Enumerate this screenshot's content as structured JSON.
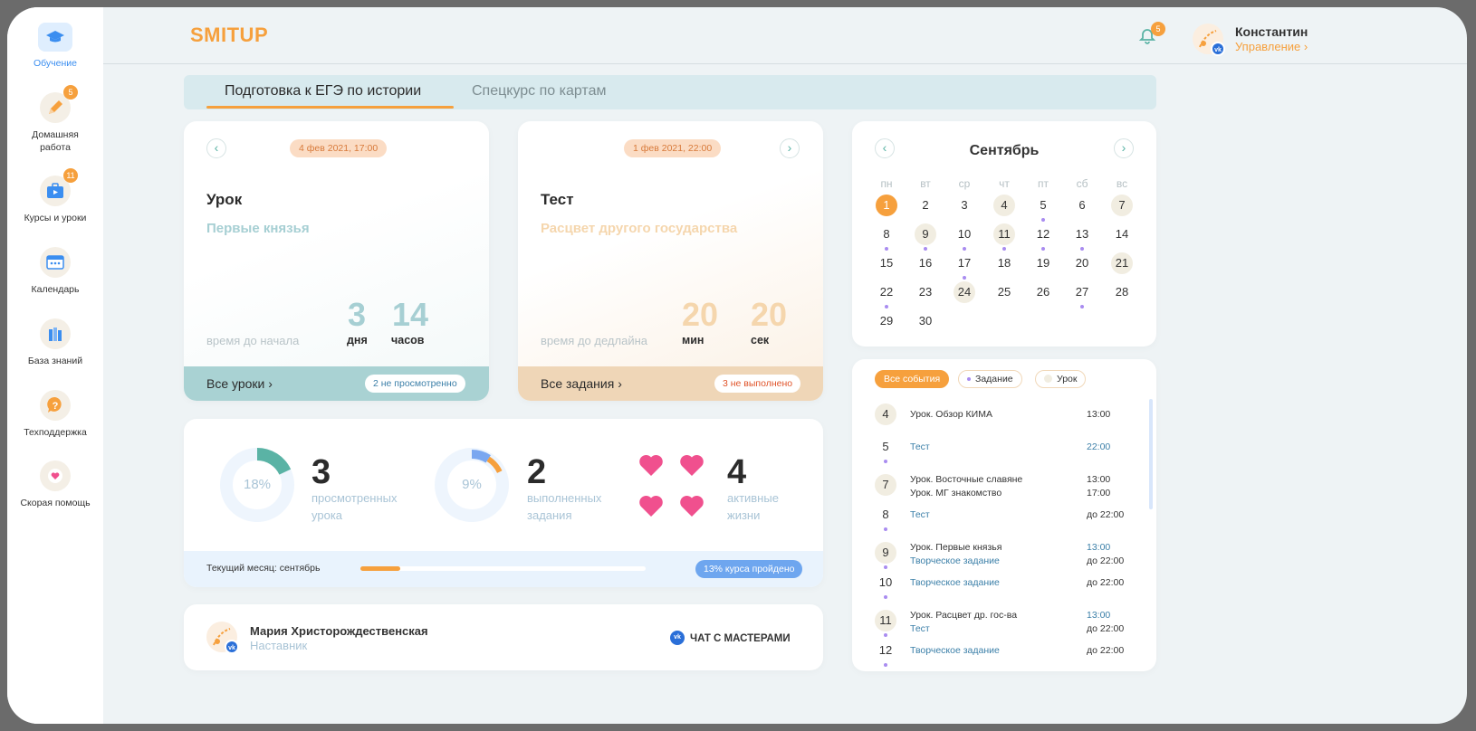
{
  "sidebar": {
    "items": [
      {
        "label": "Обучение",
        "badge": ""
      },
      {
        "label": "Домашняя работа",
        "badge": "5"
      },
      {
        "label": "Курсы и уроки",
        "badge": "11"
      },
      {
        "label": "Календарь",
        "badge": ""
      },
      {
        "label": "База знаний",
        "badge": ""
      },
      {
        "label": "Техподдержка",
        "badge": ""
      },
      {
        "label": "Скорая помощь",
        "badge": ""
      }
    ]
  },
  "header": {
    "logo": "SMITUP",
    "notifications": "5",
    "user_name": "Константин",
    "user_link": "Управление ›"
  },
  "tabs": [
    "Подготовка к ЕГЭ по истории",
    "Спецкурс по картам"
  ],
  "lesson_card": {
    "date": "4 фев 2021, 17:00",
    "title": "Урок",
    "subtitle": "Первые князья",
    "time_label": "время до начала",
    "num1": "3",
    "unit1": "дня",
    "num2": "14",
    "unit2": "часов",
    "footer_link": "Все уроки",
    "footer_pill": "2 не просмотренно"
  },
  "test_card": {
    "date": "1 фев 2021, 22:00",
    "title": "Тест",
    "subtitle": "Расцвет другого государства",
    "time_label": "время до дедлайна",
    "num1": "20",
    "unit1": "мин",
    "num2": "20",
    "unit2": "сек",
    "footer_link": "Все задания",
    "footer_pill": "3 не выполнено"
  },
  "stats": {
    "lessons_percent": "18%",
    "lessons_fraction": 0.18,
    "lessons_count": "3",
    "lessons_label1": "просмотренных",
    "lessons_label2": "урока",
    "tasks_percent": "9%",
    "tasks_fraction": 0.09,
    "tasks_count": "2",
    "tasks_label1": "выполненных",
    "tasks_label2": "задания",
    "lives_count": "4",
    "lives_label1": "активные",
    "lives_label2": "жизни",
    "month_label": "Текущий месяц: сентябрь",
    "month_progress": 0.14,
    "course_pill": "13% курса пройдено"
  },
  "mentor": {
    "name": "Мария Христорождественская",
    "role": "Наставник",
    "chat": "ЧАТ С МАСТЕРАМИ"
  },
  "calendar": {
    "month": "Сентябрь",
    "dow": [
      "пн",
      "вт",
      "ср",
      "чт",
      "пт",
      "сб",
      "вс"
    ],
    "days": [
      "1",
      "2",
      "3",
      "4",
      "5",
      "6",
      "7",
      "8",
      "9",
      "10",
      "11",
      "12",
      "13",
      "14",
      "15",
      "16",
      "17",
      "18",
      "19",
      "20",
      "21",
      "22",
      "23",
      "24",
      "25",
      "26",
      "27",
      "28",
      "29",
      "30"
    ],
    "today": "1",
    "highlighted": [
      "4",
      "7",
      "9",
      "11",
      "21",
      "24"
    ],
    "dotted": [
      "5",
      "8",
      "9",
      "10",
      "11",
      "12",
      "13",
      "17",
      "22",
      "27"
    ]
  },
  "events": {
    "filters": [
      "Все события",
      "Задание",
      "Урок"
    ],
    "items": [
      {
        "day": "4",
        "lines": [
          "Урок. Обзор КИМА"
        ],
        "times": [
          "13:00"
        ],
        "hl": true,
        "dot": false,
        "blue": [
          false
        ],
        "tblue": [
          false
        ]
      },
      {
        "day": "5",
        "lines": [
          "Тест"
        ],
        "times": [
          "22:00"
        ],
        "hl": false,
        "dot": true,
        "blue": [
          true
        ],
        "tblue": [
          true
        ]
      },
      {
        "day": "7",
        "lines": [
          "Урок. Восточные славяне",
          "Урок. МГ знакомство"
        ],
        "times": [
          "13:00",
          "17:00"
        ],
        "hl": true,
        "dot": false,
        "blue": [
          false,
          false
        ],
        "tblue": [
          false,
          false
        ]
      },
      {
        "day": "8",
        "lines": [
          "Тест"
        ],
        "times": [
          "до 22:00"
        ],
        "hl": false,
        "dot": true,
        "blue": [
          true
        ],
        "tblue": [
          false
        ]
      },
      {
        "day": "9",
        "lines": [
          "Урок. Первые князья",
          "Творческое задание"
        ],
        "times": [
          "13:00",
          "до 22:00"
        ],
        "hl": true,
        "dot": true,
        "blue": [
          false,
          true
        ],
        "tblue": [
          true,
          false
        ]
      },
      {
        "day": "10",
        "lines": [
          "Творческое задание"
        ],
        "times": [
          "до 22:00"
        ],
        "hl": false,
        "dot": true,
        "blue": [
          true
        ],
        "tblue": [
          false
        ]
      },
      {
        "day": "11",
        "lines": [
          "Урок. Расцвет др. гос-ва",
          "Тест"
        ],
        "times": [
          "13:00",
          "до 22:00"
        ],
        "hl": true,
        "dot": true,
        "blue": [
          false,
          true
        ],
        "tblue": [
          true,
          false
        ]
      },
      {
        "day": "12",
        "lines": [
          "Творческое задание"
        ],
        "times": [
          "до 22:00"
        ],
        "hl": false,
        "dot": true,
        "blue": [
          true
        ],
        "tblue": [
          false
        ]
      }
    ]
  },
  "colors": {
    "accent": "#f6a03d",
    "teal": "#5ab3a5",
    "blue": "#3b8ef0",
    "heart": "#f0508e",
    "purple_dot": "#a98cf0"
  }
}
